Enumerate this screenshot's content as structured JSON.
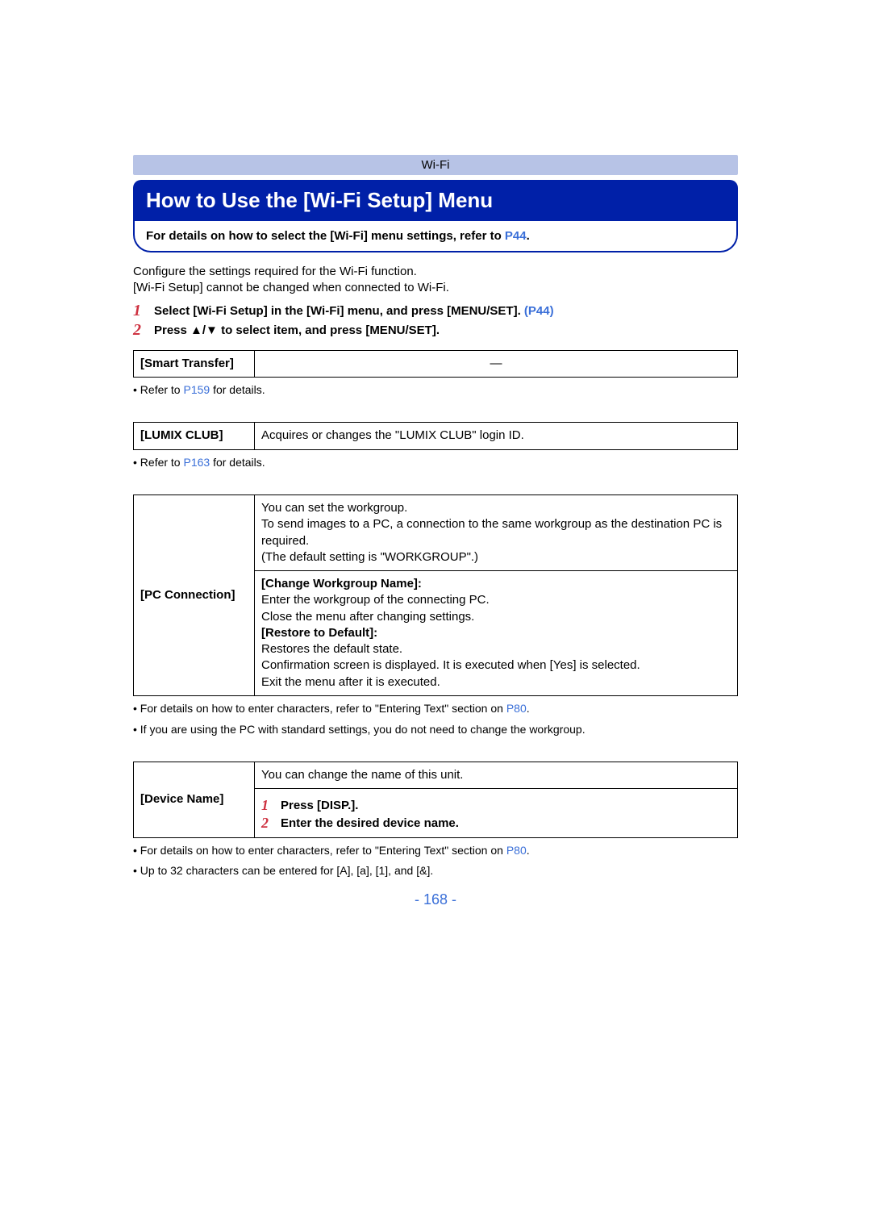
{
  "breadcrumb": "Wi-Fi",
  "title": "How to Use the [Wi-Fi Setup] Menu",
  "details_box": {
    "text_before": "For details on how to select the [Wi-Fi] menu settings, refer to ",
    "link": "P44",
    "text_after": "."
  },
  "intro_line1": "Configure the settings required for the Wi-Fi function.",
  "intro_line2": "[Wi-Fi Setup] cannot be changed when connected to Wi-Fi.",
  "steps": [
    {
      "num": "1",
      "text_before": "Select [Wi-Fi Setup] in the [Wi-Fi] menu, and press [MENU/SET]. ",
      "link": "(P44)",
      "text_after": ""
    },
    {
      "num": "2",
      "text_before": "Press ",
      "arrows": "▲/▼",
      "text_after": " to select item, and press [MENU/SET]."
    }
  ],
  "table1": {
    "label": "[Smart Transfer]",
    "value": "—"
  },
  "note1": {
    "pre": "• Refer to ",
    "link": "P159",
    "post": " for details."
  },
  "table2": {
    "label": "[LUMIX CLUB]",
    "value": "Acquires or changes the \"LUMIX CLUB\" login ID."
  },
  "note2": {
    "pre": "• Refer to ",
    "link": "P163",
    "post": " for details."
  },
  "table3": {
    "label": "[PC Connection]",
    "top_lines": [
      "You can set the workgroup.",
      "To send images to a PC, a connection to the same workgroup as the destination PC is required.",
      "(The default setting is \"WORKGROUP\".)"
    ],
    "sub1_head": "[Change Workgroup Name]:",
    "sub1_l1": "Enter the workgroup of the connecting PC.",
    "sub1_l2": "Close the menu after changing settings.",
    "sub2_head": "[Restore to Default]:",
    "sub2_l1": "Restores the default state.",
    "sub2_l2": "Confirmation screen is displayed. It is executed when [Yes] is selected.",
    "sub2_l3": "Exit the menu after it is executed."
  },
  "note3a": {
    "pre": "• For details on how to enter characters, refer to \"Entering Text\" section on ",
    "link": "P80",
    "post": "."
  },
  "note3b": "• If you are using the PC with standard settings, you do not need to change the workgroup.",
  "table4": {
    "label": "[Device Name]",
    "top": "You can change the name of this unit.",
    "steps": [
      {
        "num": "1",
        "text": "Press [DISP.]."
      },
      {
        "num": "2",
        "text": "Enter the desired device name."
      }
    ]
  },
  "note4a": {
    "pre": "• For details on how to enter characters, refer to \"Entering Text\" section on ",
    "link": "P80",
    "post": "."
  },
  "note4b": "• Up to 32 characters can be entered for [A], [a], [1], and [&].",
  "page_number": "- 168 -"
}
